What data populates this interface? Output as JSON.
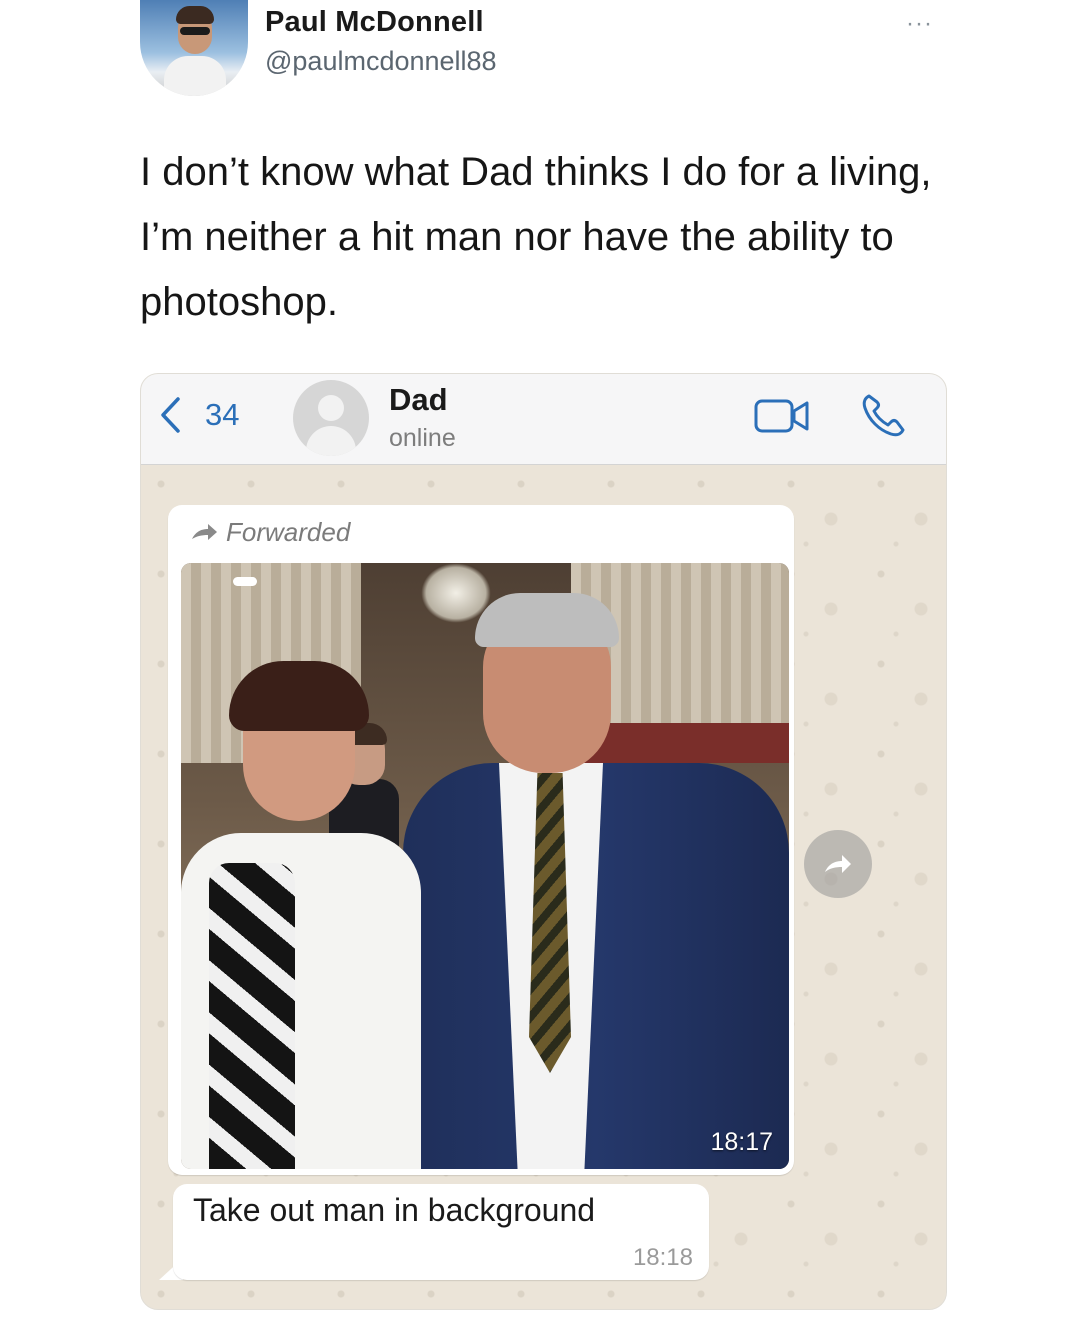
{
  "tweet": {
    "author_name": "Paul McDonnell",
    "author_handle": "@paulmcdonnell88",
    "menu_icon": "more-dots-icon",
    "more_symbol": "···",
    "text": "I don’t know what Dad thinks I do for a living, I’m neither a hit man nor have the ability to photoshop."
  },
  "whatsapp": {
    "back_count": "34",
    "contact_name": "Dad",
    "contact_status": "online",
    "accent_color": "#2b6fb8",
    "icons": [
      "back-chevron-icon",
      "video-call-icon",
      "phone-call-icon",
      "forward-arrow-icon",
      "share-icon"
    ],
    "messages": [
      {
        "type": "image",
        "forwarded_label": "Forwarded",
        "time": "18:17"
      },
      {
        "type": "text",
        "text": "Take out man in background",
        "time": "18:18"
      }
    ]
  }
}
